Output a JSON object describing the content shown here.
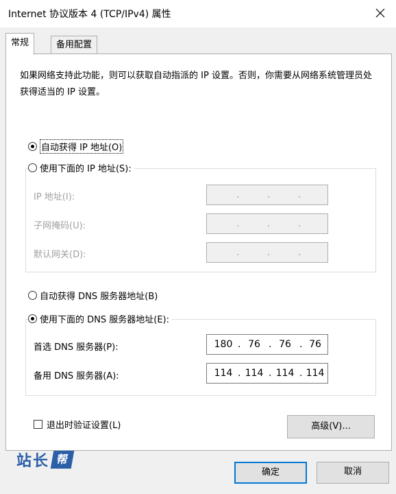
{
  "window": {
    "title": "Internet 协议版本 4 (TCP/IPv4) 属性"
  },
  "tabs": [
    {
      "label": "常规"
    },
    {
      "label": "备用配置"
    }
  ],
  "description": "如果网络支持此功能，则可以获取自动指派的 IP 设置。否则，你需要从网络系统管理员处获得适当的 IP 设置。",
  "ip": {
    "auto_label": "自动获得 IP 地址(O)",
    "manual_label": "使用下面的 IP 地址(S):",
    "selected": "auto",
    "fields": [
      {
        "label": "IP 地址(I):",
        "value": [
          " ",
          " ",
          " ",
          " "
        ]
      },
      {
        "label": "子网掩码(U):",
        "value": [
          " ",
          " ",
          " ",
          " "
        ]
      },
      {
        "label": "默认网关(D):",
        "value": [
          " ",
          " ",
          " ",
          " "
        ]
      }
    ]
  },
  "dns": {
    "auto_label": "自动获得 DNS 服务器地址(B)",
    "manual_label": "使用下面的 DNS 服务器地址(E):",
    "selected": "manual",
    "preferred_label": "首选 DNS 服务器(P):",
    "preferred_value": [
      "180",
      "76",
      "76",
      "76"
    ],
    "alternate_label": "备用 DNS 服务器(A):",
    "alternate_value": [
      "114",
      "114",
      "114",
      "114"
    ]
  },
  "validate_checkbox": {
    "label": "退出时验证设置(L)",
    "checked": false
  },
  "buttons": {
    "advanced": "高级(V)...",
    "ok": "确定",
    "cancel": "取消"
  },
  "watermark": {
    "text": "站长",
    "badge": "帮"
  }
}
